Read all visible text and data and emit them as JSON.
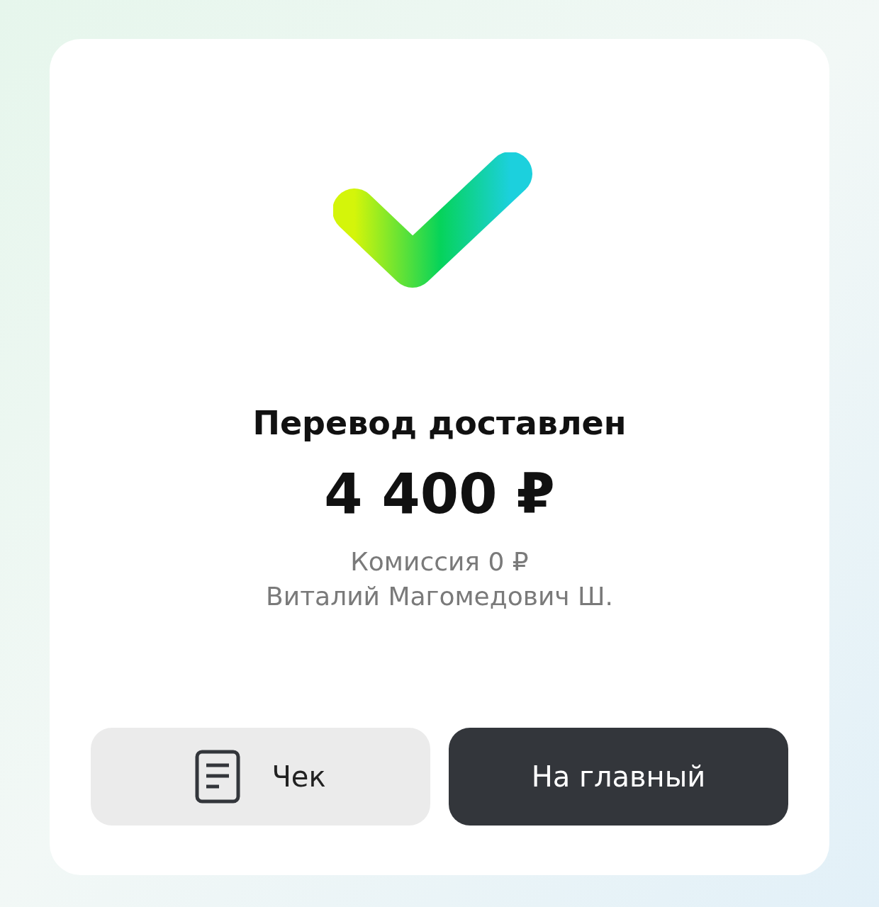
{
  "status": {
    "title": "Перевод доставлен",
    "amount": "4 400 ₽"
  },
  "details": [
    "Комиссия 0 ₽",
    "Виталий Магомедович Ш."
  ],
  "buttons": [
    {
      "label": "Чек",
      "kind": "secondary"
    },
    {
      "label": "На главный",
      "kind": "primary"
    }
  ]
}
